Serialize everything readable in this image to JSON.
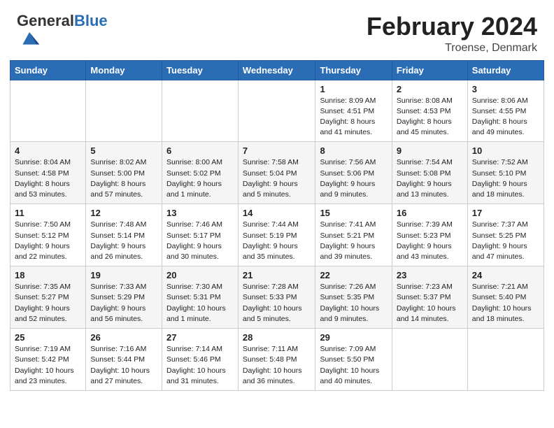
{
  "header": {
    "logo_general": "General",
    "logo_blue": "Blue",
    "title": "February 2024",
    "subtitle": "Troense, Denmark"
  },
  "weekdays": [
    "Sunday",
    "Monday",
    "Tuesday",
    "Wednesday",
    "Thursday",
    "Friday",
    "Saturday"
  ],
  "weeks": [
    [
      null,
      null,
      null,
      null,
      {
        "day": "1",
        "sunrise": "8:09 AM",
        "sunset": "4:51 PM",
        "daylight": "8 hours and 41 minutes."
      },
      {
        "day": "2",
        "sunrise": "8:08 AM",
        "sunset": "4:53 PM",
        "daylight": "8 hours and 45 minutes."
      },
      {
        "day": "3",
        "sunrise": "8:06 AM",
        "sunset": "4:55 PM",
        "daylight": "8 hours and 49 minutes."
      }
    ],
    [
      {
        "day": "4",
        "sunrise": "8:04 AM",
        "sunset": "4:58 PM",
        "daylight": "8 hours and 53 minutes."
      },
      {
        "day": "5",
        "sunrise": "8:02 AM",
        "sunset": "5:00 PM",
        "daylight": "8 hours and 57 minutes."
      },
      {
        "day": "6",
        "sunrise": "8:00 AM",
        "sunset": "5:02 PM",
        "daylight": "9 hours and 1 minute."
      },
      {
        "day": "7",
        "sunrise": "7:58 AM",
        "sunset": "5:04 PM",
        "daylight": "9 hours and 5 minutes."
      },
      {
        "day": "8",
        "sunrise": "7:56 AM",
        "sunset": "5:06 PM",
        "daylight": "9 hours and 9 minutes."
      },
      {
        "day": "9",
        "sunrise": "7:54 AM",
        "sunset": "5:08 PM",
        "daylight": "9 hours and 13 minutes."
      },
      {
        "day": "10",
        "sunrise": "7:52 AM",
        "sunset": "5:10 PM",
        "daylight": "9 hours and 18 minutes."
      }
    ],
    [
      {
        "day": "11",
        "sunrise": "7:50 AM",
        "sunset": "5:12 PM",
        "daylight": "9 hours and 22 minutes."
      },
      {
        "day": "12",
        "sunrise": "7:48 AM",
        "sunset": "5:14 PM",
        "daylight": "9 hours and 26 minutes."
      },
      {
        "day": "13",
        "sunrise": "7:46 AM",
        "sunset": "5:17 PM",
        "daylight": "9 hours and 30 minutes."
      },
      {
        "day": "14",
        "sunrise": "7:44 AM",
        "sunset": "5:19 PM",
        "daylight": "9 hours and 35 minutes."
      },
      {
        "day": "15",
        "sunrise": "7:41 AM",
        "sunset": "5:21 PM",
        "daylight": "9 hours and 39 minutes."
      },
      {
        "day": "16",
        "sunrise": "7:39 AM",
        "sunset": "5:23 PM",
        "daylight": "9 hours and 43 minutes."
      },
      {
        "day": "17",
        "sunrise": "7:37 AM",
        "sunset": "5:25 PM",
        "daylight": "9 hours and 47 minutes."
      }
    ],
    [
      {
        "day": "18",
        "sunrise": "7:35 AM",
        "sunset": "5:27 PM",
        "daylight": "9 hours and 52 minutes."
      },
      {
        "day": "19",
        "sunrise": "7:33 AM",
        "sunset": "5:29 PM",
        "daylight": "9 hours and 56 minutes."
      },
      {
        "day": "20",
        "sunrise": "7:30 AM",
        "sunset": "5:31 PM",
        "daylight": "10 hours and 1 minute."
      },
      {
        "day": "21",
        "sunrise": "7:28 AM",
        "sunset": "5:33 PM",
        "daylight": "10 hours and 5 minutes."
      },
      {
        "day": "22",
        "sunrise": "7:26 AM",
        "sunset": "5:35 PM",
        "daylight": "10 hours and 9 minutes."
      },
      {
        "day": "23",
        "sunrise": "7:23 AM",
        "sunset": "5:37 PM",
        "daylight": "10 hours and 14 minutes."
      },
      {
        "day": "24",
        "sunrise": "7:21 AM",
        "sunset": "5:40 PM",
        "daylight": "10 hours and 18 minutes."
      }
    ],
    [
      {
        "day": "25",
        "sunrise": "7:19 AM",
        "sunset": "5:42 PM",
        "daylight": "10 hours and 23 minutes."
      },
      {
        "day": "26",
        "sunrise": "7:16 AM",
        "sunset": "5:44 PM",
        "daylight": "10 hours and 27 minutes."
      },
      {
        "day": "27",
        "sunrise": "7:14 AM",
        "sunset": "5:46 PM",
        "daylight": "10 hours and 31 minutes."
      },
      {
        "day": "28",
        "sunrise": "7:11 AM",
        "sunset": "5:48 PM",
        "daylight": "10 hours and 36 minutes."
      },
      {
        "day": "29",
        "sunrise": "7:09 AM",
        "sunset": "5:50 PM",
        "daylight": "10 hours and 40 minutes."
      },
      null,
      null
    ]
  ],
  "labels": {
    "sunrise": "Sunrise: ",
    "sunset": "Sunset: ",
    "daylight": "Daylight: "
  }
}
